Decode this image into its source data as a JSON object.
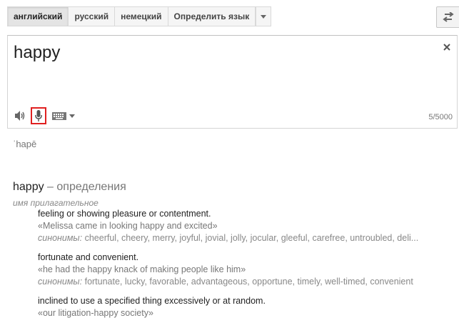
{
  "source_languages": {
    "tabs": [
      {
        "label": "английский",
        "active": true
      },
      {
        "label": "русский",
        "active": false
      },
      {
        "label": "немецкий",
        "active": false
      },
      {
        "label": "Определить язык",
        "active": false
      }
    ],
    "dropdown_icon": "chevron-down-icon"
  },
  "swap_icon": "swap-languages-icon",
  "input": {
    "text": "happy",
    "clear_icon": "close-icon",
    "char_count": "5/5000",
    "tools": {
      "listen_icon": "speaker-icon",
      "voice_icon": "microphone-icon",
      "keyboard_icon": "keyboard-icon"
    }
  },
  "transliteration": "ˈhapē",
  "definitions": {
    "word": "happy",
    "heading_suffix": " – определения",
    "part_of_speech": "имя прилагательное",
    "synonyms_label": "синонимы:",
    "senses": [
      {
        "gloss": "feeling or showing pleasure or contentment.",
        "example": "«Melissa came in looking happy and excited»",
        "synonyms": "cheerful, cheery, merry, joyful, jovial, jolly, jocular, gleeful, carefree, untroubled, deli..."
      },
      {
        "gloss": "fortunate and convenient.",
        "example": "«he had the happy knack of making people like him»",
        "synonyms": "fortunate, lucky, favorable, advantageous, opportune, timely, well-timed, convenient"
      },
      {
        "gloss": "inclined to use a specified thing excessively or at random.",
        "example": "«our litigation-happy society»"
      }
    ]
  }
}
